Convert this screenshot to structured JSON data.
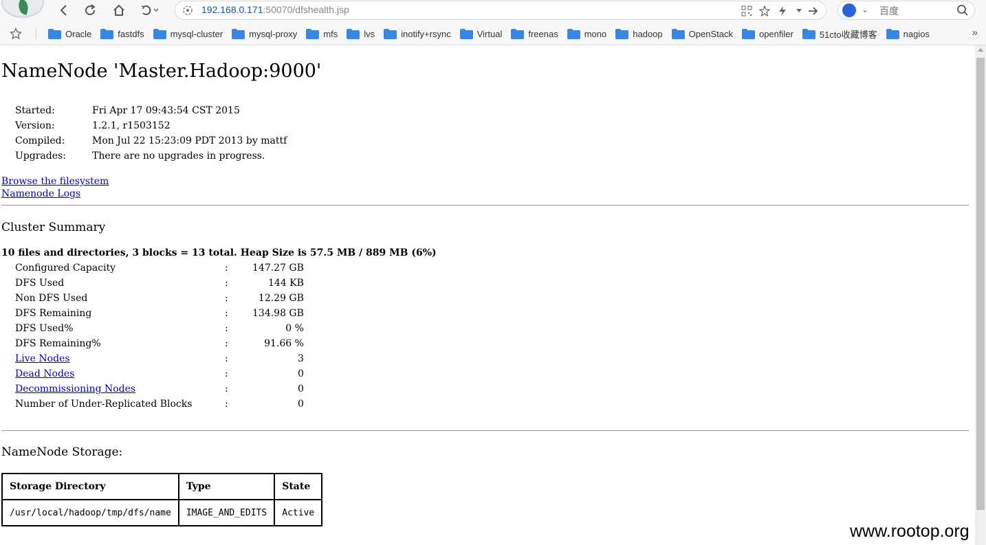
{
  "browser": {
    "url_host": "192.168.0.171",
    "url_rest": ":50070/dfshealth.jsp",
    "search_placeholder": "百度",
    "more_label": "»",
    "bookmarks": [
      "Oracle",
      "fastdfs",
      "mysql-cluster",
      "mysql-proxy",
      "mfs",
      "lvs",
      "inotify+rsync",
      "Virtual",
      "freenas",
      "mono",
      "hadoop",
      "OpenStack",
      "openfiler",
      "51cto收藏博客",
      "nagios"
    ]
  },
  "page": {
    "title": "NameNode 'Master.Hadoop:9000'",
    "info": [
      {
        "key": "Started:",
        "value": "Fri Apr 17 09:43:54 CST 2015"
      },
      {
        "key": "Version:",
        "value": "1.2.1, r1503152"
      },
      {
        "key": "Compiled:",
        "value": "Mon Jul 22 15:23:09 PDT 2013 by mattf"
      },
      {
        "key": "Upgrades:",
        "value": "There are no upgrades in progress."
      }
    ],
    "links": {
      "browse": "Browse the filesystem",
      "logs": "Namenode Logs"
    }
  },
  "cluster": {
    "title": "Cluster Summary",
    "summary_line": "10 files and directories, 3 blocks = 13 total. Heap Size is 57.5 MB / 889 MB (6%)",
    "rows": [
      {
        "label": "Configured Capacity",
        "value": "147.27 GB",
        "link": false
      },
      {
        "label": "DFS Used",
        "value": "144 KB",
        "link": false
      },
      {
        "label": "Non DFS Used",
        "value": "12.29 GB",
        "link": false
      },
      {
        "label": "DFS Remaining",
        "value": "134.98 GB",
        "link": false
      },
      {
        "label": "DFS Used%",
        "value": "0 %",
        "link": false
      },
      {
        "label": "DFS Remaining%",
        "value": "91.66 %",
        "link": false
      },
      {
        "label": "Live Nodes",
        "value": "3",
        "link": true
      },
      {
        "label": "Dead Nodes",
        "value": "0",
        "link": true
      },
      {
        "label": "Decommissioning Nodes",
        "value": "0",
        "link": true
      },
      {
        "label": "Number of Under-Replicated Blocks",
        "value": "0",
        "link": false
      }
    ],
    "colon": ":"
  },
  "storage": {
    "title": "NameNode Storage:",
    "headers": [
      "Storage Directory",
      "Type",
      "State"
    ],
    "rows": [
      [
        "/usr/local/hadoop/tmp/dfs/name",
        "IMAGE_AND_EDITS",
        "Active"
      ]
    ]
  },
  "watermark": "www.rootop.org"
}
